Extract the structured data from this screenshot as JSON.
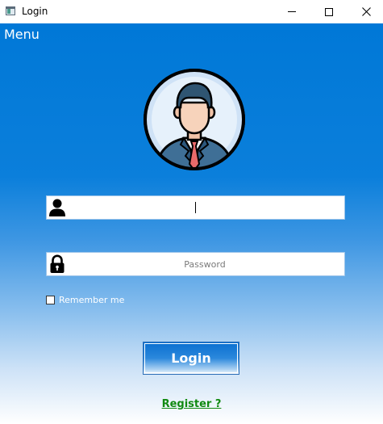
{
  "window": {
    "title": "Login"
  },
  "menu": {
    "label": "Menu"
  },
  "form": {
    "username": {
      "value": "",
      "placeholder": ""
    },
    "password": {
      "value": "",
      "placeholder": "Password"
    },
    "remember_label": "Remember me",
    "remember_checked": false,
    "login_label": "Login",
    "register_label": "Register ?"
  },
  "icons": {
    "app": "app-window-icon",
    "avatar": "businessman-avatar-icon",
    "user": "user-icon",
    "lock": "lock-icon",
    "minimize": "minimize-icon",
    "maximize": "maximize-icon",
    "close": "close-icon"
  },
  "colors": {
    "accent": "#0078d7",
    "register_link": "#118a11",
    "text_on_accent": "#ffffff"
  }
}
